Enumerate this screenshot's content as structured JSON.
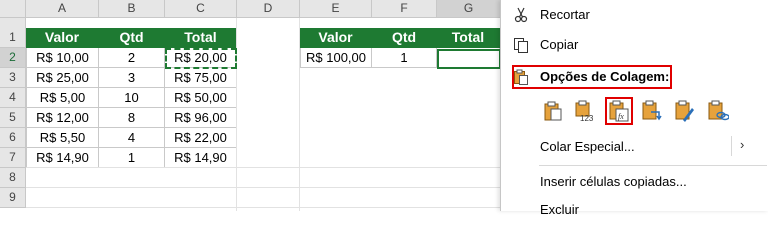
{
  "columns": [
    "A",
    "B",
    "C",
    "D",
    "E",
    "F",
    "G"
  ],
  "rows": [
    "1",
    "2",
    "3",
    "4",
    "5",
    "6",
    "7",
    "8",
    "9"
  ],
  "table1": {
    "headers": [
      "Valor",
      "Qtd",
      "Total"
    ],
    "rows": [
      [
        "R$ 10,00",
        "2",
        "R$ 20,00"
      ],
      [
        "R$ 25,00",
        "3",
        "R$ 75,00"
      ],
      [
        "R$ 5,00",
        "10",
        "R$ 50,00"
      ],
      [
        "R$ 12,00",
        "8",
        "R$ 96,00"
      ],
      [
        "R$ 5,50",
        "4",
        "R$ 22,00"
      ],
      [
        "R$ 14,90",
        "1",
        "R$ 14,90"
      ]
    ]
  },
  "table2": {
    "headers": [
      "Valor",
      "Qtd",
      "Total"
    ],
    "row": [
      "R$ 100,00",
      "1",
      ""
    ]
  },
  "context_menu": {
    "cut": "Recortar",
    "copy": "Copiar",
    "paste_options": "Opções de Colagem:",
    "paste_special": "Colar Especial...",
    "insert_copied": "Inserir células copiadas...",
    "delete": "Excluir"
  },
  "colors": {
    "header_green": "#1e7a32",
    "highlight_red": "#e00000"
  }
}
